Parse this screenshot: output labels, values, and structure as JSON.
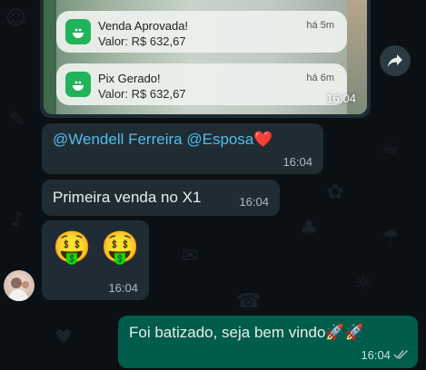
{
  "image_message": {
    "notifications": [
      {
        "title": "Venda Aprovada!",
        "value": "Valor: R$ 632,67",
        "ago": "há 5m"
      },
      {
        "title": "Pix Gerado!",
        "value": "Valor: R$ 632,67",
        "ago": "há 6m"
      }
    ],
    "time": "16:04"
  },
  "messages": {
    "mention": {
      "mention1": "@Wendell Ferreira",
      "mention2": "@Esposa",
      "emoji": "❤️",
      "time": "16:04"
    },
    "first_sale": {
      "text": "Primeira venda no X1",
      "time": "16:04"
    },
    "emoji_msg": {
      "emojis": "🤑 🤑",
      "time": "16:04"
    },
    "outgoing": {
      "text": "Foi batizado, seja bem vindo🚀🚀",
      "time": "16:04"
    }
  },
  "colors": {
    "incoming": "#1f2c33",
    "outgoing": "#005c4b",
    "mention": "#53bdeb",
    "background": "#0b1014"
  },
  "icons": [
    "forward-icon",
    "app-icon",
    "read-check-icon",
    "avatar"
  ]
}
